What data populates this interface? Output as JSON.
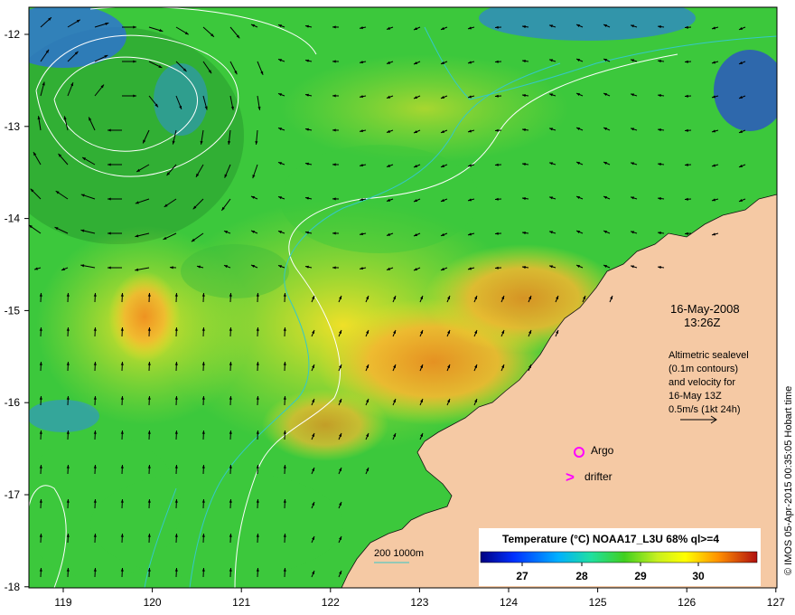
{
  "map": {
    "date": "16-May-2008",
    "time": "13:26Z",
    "altimetric_note": [
      "Altimetric sealevel",
      "(0.1m contours)",
      "and velocity for",
      "16-May 13Z",
      "0.5m/s (1kt 24h)"
    ],
    "argo_label": "Argo",
    "drifter_label": "drifter",
    "drifter_symbol": ">",
    "bathymetry_label": "200  1000m",
    "colorbar_title": "Temperature (°C) NOAA17_L3U 68% ql>=4",
    "colorbar_ticks": [
      "27",
      "28",
      "29",
      "30"
    ],
    "credit": "© IMOS 05-Apr-2015 00:35:05 Hobart time",
    "lon_ticks": [
      "119",
      "120",
      "121",
      "122",
      "123",
      "124",
      "125",
      "126",
      "127"
    ],
    "lat_ticks": [
      "-12",
      "-13",
      "-14",
      "-15",
      "-16",
      "-17",
      "-18"
    ]
  },
  "colors": {
    "land": "#f5c9a4",
    "sst_cool": "#2e6fd8",
    "sst_mid": "#3cc83c",
    "sst_warm": "#f0e020",
    "sst_hot": "#f08a20",
    "contour": "#ffffff",
    "bathymetry": "#35c8c8",
    "argo_marker": "#ff00ff"
  }
}
